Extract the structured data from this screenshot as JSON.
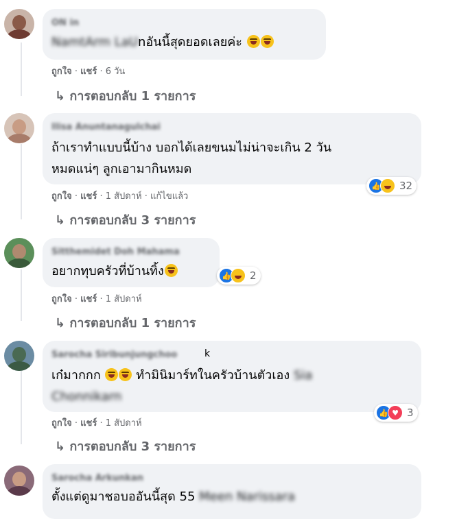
{
  "comments": [
    {
      "name": "ON in",
      "text_blurred": "NamtArm LaU",
      "text": "nอันนี้สุดยอดเลยค่ะ",
      "emoji": [
        "face-with-tears-of-joy-icon",
        "face-with-tears-of-joy-icon"
      ],
      "actions": {
        "like": "ถูกใจ",
        "share": "แชร์",
        "time": "6 วัน"
      },
      "replies": "↳ การตอบกลับ 1 รายการ"
    },
    {
      "name": "Ilisa Anuntanagulchai",
      "line1": "ถ้าเราทำแบบนี้บ้าง บอกได้เลยขนมไม่น่าจะเกิน 2 วัน",
      "line2": "หมดแน่ๆ ลูกเอามากินหมด",
      "actions": {
        "like": "ถูกใจ",
        "share": "แชร์",
        "time": "1 สัปดาห์",
        "edited": "แก้ไขแล้ว"
      },
      "reactions": {
        "icons": [
          "like-icon",
          "haha-icon"
        ],
        "count": "32"
      },
      "replies": "↳ การตอบกลับ 3 รายการ"
    },
    {
      "name": "Sitthemidet Doh Mahama",
      "text": "อยากทุบครัวที่บ้านทิ้ง",
      "emoji": [
        "face-with-tears-of-joy-icon"
      ],
      "actions": {
        "like": "ถูกใจ",
        "share": "แชร์",
        "time": "1 สัปดาห์"
      },
      "reactions": {
        "icons": [
          "like-icon",
          "haha-icon"
        ],
        "count": "2"
      },
      "replies": "↳ การตอบกลับ 1 รายการ"
    },
    {
      "name": "Sarocha Siribunjungchoo",
      "name_tail": "k",
      "text_a": "เก๋มากกก",
      "emoji": [
        "face-with-tears-of-joy-icon",
        "face-with-tears-of-joy-icon"
      ],
      "text_b": "ทำมินิมาร์ทในครัวบ้านตัวเอง",
      "mention_a": "Sia",
      "mention_b": "Chonnikarn",
      "actions": {
        "like": "ถูกใจ",
        "share": "แชร์",
        "time": "1 สัปดาห์"
      },
      "reactions": {
        "icons": [
          "like-icon",
          "love-icon"
        ],
        "count": "3"
      },
      "replies": "↳ การตอบกลับ 3 รายการ"
    },
    {
      "name": "Sarocha Arkunkan",
      "text": "ตั้งแต่ดูมาชอบออันนี้สุด 55",
      "mention": "Meen Narissara"
    }
  ],
  "colors": {
    "bubble": "#f0f2f5",
    "meta": "#65676b",
    "like": "#1b74e4",
    "love": "#f33e58",
    "haha": "#f7c21b"
  }
}
